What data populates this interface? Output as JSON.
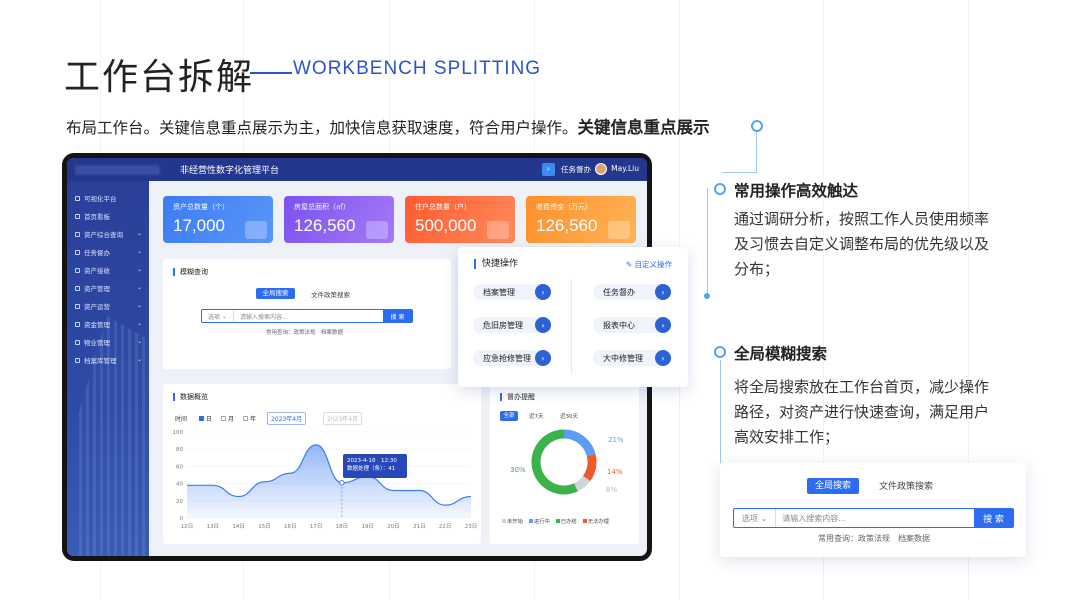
{
  "heading": {
    "title": "工作台拆解",
    "title_en": "WORKBENCH SPLITTING",
    "subtitle_normal": "布局工作台。关键信息重点展示为主，加快信息获取速度，符合用户操作。",
    "subtitle_bold": "关键信息重点展示"
  },
  "features": [
    {
      "title": "常用操作高效触达",
      "lines": [
        "通过调研分析，按照工作人员使用频率",
        "及习惯去自定义调整布局的优先级以及",
        "分布；"
      ]
    },
    {
      "title": "全局模糊搜索",
      "lines": [
        "将全局搜索放在工作台首页，减少操作",
        "路径，对资产进行快速查询，满足用户",
        "高效安排工作；"
      ]
    }
  ],
  "app": {
    "platform_name": "非经营性数字化管理平台",
    "task_label": "任务督办",
    "user_name": "May.Liu",
    "sidebar": [
      "可视化平台",
      "首页看板",
      "资产综合查询",
      "任务督办",
      "资产接收",
      "资产管理",
      "资产运营",
      "资金管理",
      "物业管理",
      "档案库管理"
    ],
    "stats": [
      {
        "label": "资产总数量（个）",
        "value": "17,000",
        "color": "#3b7cf2"
      },
      {
        "label": "房屋总面积（㎡）",
        "value": "126,560",
        "color": "#8a5af0"
      },
      {
        "label": "住户总数量（户）",
        "value": "500,000",
        "color": "#ff6a3d"
      },
      {
        "label": "收费资金（万元）",
        "value": "126,560",
        "color": "#ffa03a"
      }
    ],
    "fuzzy": {
      "title": "模糊查询",
      "tab_all": "全局搜索",
      "tab_docs": "文件政策搜索",
      "select": "选项",
      "placeholder": "请输入搜索内容...",
      "button": "搜 索",
      "hint": "常用查询：政策法规　档案数据"
    },
    "quick": {
      "title": "快捷操作",
      "custom": "自定义操作",
      "items": [
        "档案管理",
        "任务督办",
        "危旧房管理",
        "报表中心",
        "应急抢修管理",
        "大中修管理"
      ]
    },
    "overview": {
      "title": "数据概览",
      "time_label": "时间",
      "opts": [
        "日",
        "月",
        "年"
      ],
      "date": "2023年4月",
      "date2": "2023年4月",
      "tooltip_date": "2023-4-18　12:30",
      "tooltip_value": "数据处理（条）：41"
    },
    "todo": {
      "title": "督办提醒",
      "tabs": [
        "全部",
        "近7天",
        "近30天"
      ],
      "legend": [
        "未开始",
        "进行中",
        "已办结",
        "无法办理"
      ]
    }
  },
  "big_search": {
    "tab_all": "全局搜索",
    "tab_docs": "文件政策搜索",
    "select": "选项",
    "placeholder": "请输入搜索内容...",
    "button": "搜 索",
    "hint": "常用查询：政策法规　档案数据"
  },
  "chart_data": [
    {
      "type": "area",
      "title": "数据概览",
      "categories": [
        "12日",
        "13日",
        "14日",
        "15日",
        "16日",
        "17日",
        "18日",
        "19日",
        "20日",
        "21日",
        "22日",
        "23日"
      ],
      "values": [
        38,
        38,
        25,
        42,
        52,
        85,
        41,
        48,
        32,
        32,
        15,
        25
      ],
      "ylim": [
        0,
        100
      ],
      "yticks": [
        0,
        20,
        40,
        60,
        80,
        100
      ],
      "color": "#3b7cf2",
      "highlight": {
        "category": "18日",
        "value": 41
      }
    },
    {
      "type": "pie",
      "title": "督办提醒",
      "labels": [
        "进行中",
        "无法办理",
        "未开始",
        "已办结"
      ],
      "values": [
        21,
        14,
        8,
        57
      ],
      "display_labels": [
        "21%",
        "14%",
        "8%",
        "30%"
      ],
      "colors": [
        "#5b9cf5",
        "#ee5a2a",
        "#cfd3da",
        "#3cb24a"
      ]
    }
  ]
}
